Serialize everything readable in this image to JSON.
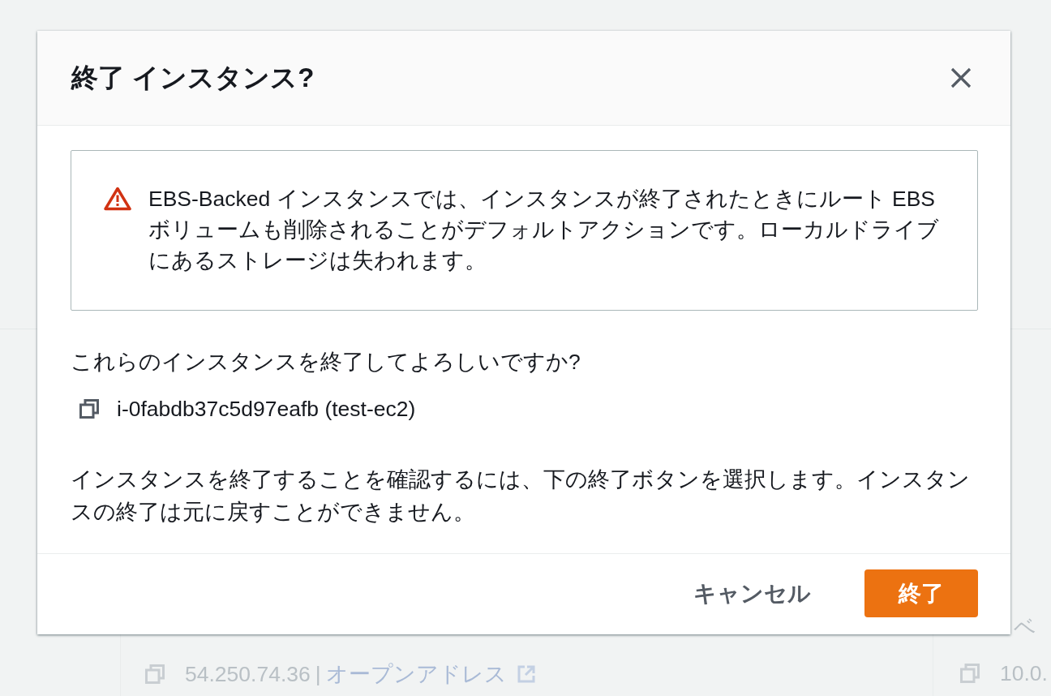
{
  "background": {
    "side_label": "ベ",
    "public_ip": {
      "value": "54.250.74.36",
      "separator": "|",
      "link": "オープンアドレス"
    },
    "private_ip": {
      "value": "10.0."
    }
  },
  "dialog": {
    "title": "終了 インスタンス?",
    "warning": {
      "text": "EBS-Backed インスタンスでは、インスタンスが終了されたときにルート EBS ボリュームも削除されることがデフォルトアクションです。ローカルドライブにあるストレージは失われます。"
    },
    "question": "これらのインスタンスを終了してよろしいですか?",
    "instances": [
      {
        "label": "i-0fabdb37c5d97eafb (test-ec2)"
      }
    ],
    "note": "インスタンスを終了することを確認するには、下の終了ボタンを選択します。インスタンスの終了は元に戻すことができません。",
    "buttons": [
      {
        "label": "キャンセル",
        "kind": "link"
      },
      {
        "label": "終了",
        "kind": "primary"
      }
    ]
  }
}
